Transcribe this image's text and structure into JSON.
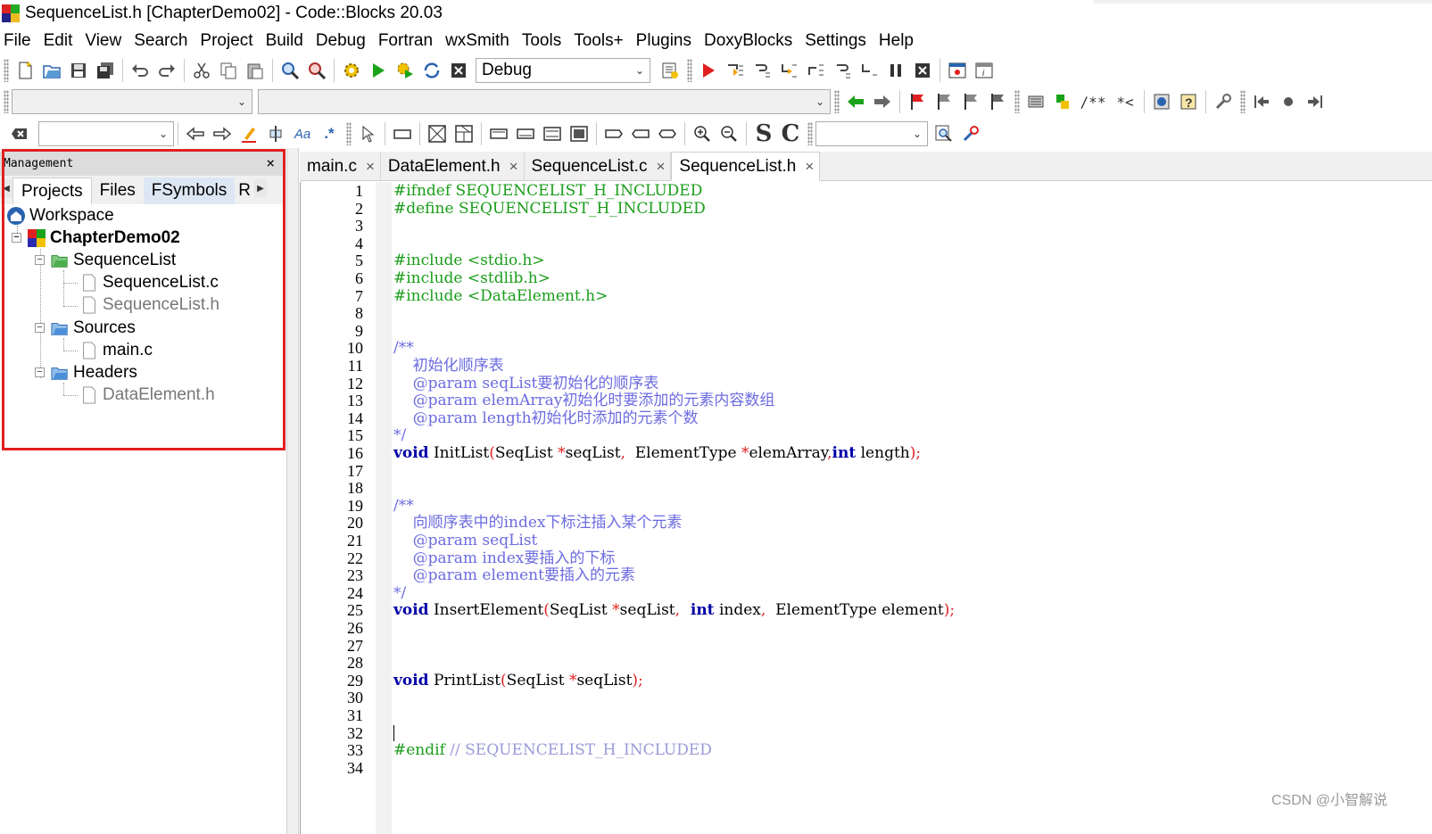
{
  "window": {
    "title": "SequenceList.h [ChapterDemo02] - Code::Blocks 20.03"
  },
  "menu": [
    "File",
    "Edit",
    "View",
    "Search",
    "Project",
    "Build",
    "Debug",
    "Fortran",
    "wxSmith",
    "Tools",
    "Tools+",
    "Plugins",
    "DoxyBlocks",
    "Settings",
    "Help"
  ],
  "toolbar": {
    "build_target": "Debug",
    "doxy_comment": "/**",
    "doxy_inline": "*<",
    "search_s": "S",
    "search_c": "C",
    "regex_label": "Aa"
  },
  "management": {
    "title": "Management",
    "close": "×",
    "tabs": [
      "Projects",
      "Files",
      "FSymbols",
      "R"
    ],
    "tree": {
      "workspace": "Workspace",
      "project": "ChapterDemo02",
      "folder_sequencelist": "SequenceList",
      "file_seq_c": "SequenceList.c",
      "file_seq_h": "SequenceList.h",
      "folder_sources": "Sources",
      "file_main_c": "main.c",
      "folder_headers": "Headers",
      "file_dataelement_h": "DataElement.h"
    }
  },
  "editor": {
    "tabs": [
      {
        "label": "main.c",
        "active": false
      },
      {
        "label": "DataElement.h",
        "active": false
      },
      {
        "label": "SequenceList.c",
        "active": false
      },
      {
        "label": "SequenceList.h",
        "active": true
      }
    ],
    "tab_close": "×",
    "line_count": 34,
    "code": {
      "l1": "#ifndef SEQUENCELIST_H_INCLUDED",
      "l2": "#define SEQUENCELIST_H_INCLUDED",
      "l5_pp": "#include ",
      "l5_inc": "<stdio.h>",
      "l6_pp": "#include ",
      "l6_inc": "<stdlib.h>",
      "l7_pp": "#include ",
      "l7_inc": "<DataElement.h>",
      "l10": "/**",
      "l11": "    初始化顺序表",
      "l12_tag": "    @param ",
      "l12_text": "seqList要初始化的顺序表",
      "l13_tag": "    @param ",
      "l13_text": "elemArray初始化时要添加的元素内容数组",
      "l14_tag": "    @param ",
      "l14_text": "length初始化时添加的元素个数",
      "l15": "*/",
      "l16_kw": "void",
      "l16_a": " InitList",
      "l16_b": "(",
      "l16_c": "SeqList ",
      "l16_d": "*",
      "l16_e": "seqList",
      "l16_f": ",",
      "l16_g": "  ElementType ",
      "l16_h": "*",
      "l16_i": "elemArray",
      "l16_j": ",",
      "l16_kw2": "int",
      "l16_k": " length",
      "l16_l": ");",
      "l19": "/**",
      "l20": "    向顺序表中的index下标注插入某个元素",
      "l21_tag": "    @param ",
      "l21_text": "seqList",
      "l22_tag": "    @param ",
      "l22_text": "index要插入的下标",
      "l23_tag": "    @param ",
      "l23_text": "element要插入的元素",
      "l24": "*/",
      "l25_kw": "void",
      "l25_a": " InsertElement",
      "l25_b": "(",
      "l25_c": "SeqList ",
      "l25_d": "*",
      "l25_e": "seqList",
      "l25_f": ",",
      "l25_kw2": "  int",
      "l25_g": " index",
      "l25_h": ",",
      "l25_i": "  ElementType element",
      "l25_j": ");",
      "l29_kw": "void",
      "l29_a": " PrintList",
      "l29_b": "(",
      "l29_c": "SeqList ",
      "l29_d": "*",
      "l29_e": "seqList",
      "l29_f": ");",
      "l33_pp": "#endif ",
      "l33_cm": "// SEQUENCELIST_H_INCLUDED"
    }
  },
  "watermark": "CSDN @小智解说",
  "colors": {
    "preprocessor": "#1a9d1a",
    "comment": "#6b6be0",
    "keyword": "#0000a8",
    "operator": "#e02020",
    "highlight": "#e02020"
  }
}
